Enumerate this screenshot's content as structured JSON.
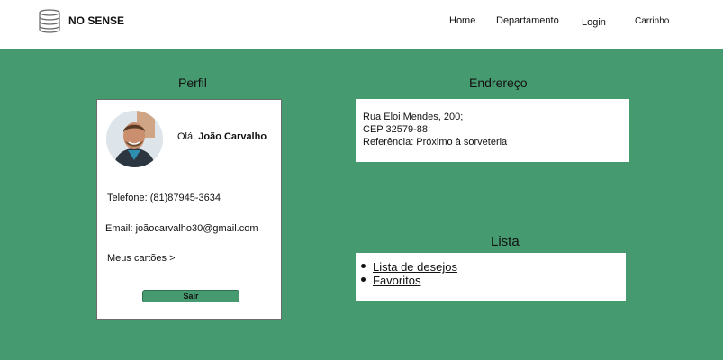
{
  "header": {
    "brand": "NO SENSE",
    "logo_icon": "database-stack-icon",
    "nav": {
      "home": "Home",
      "departamento": "Departamento",
      "login": "Login",
      "carrinho": "Carrinho"
    }
  },
  "perfil": {
    "title": "Perfil",
    "greeting_prefix": "Olá,",
    "name": "João Carvalho",
    "phone": "Telefone: (81)87945-3634",
    "email": "Email: joãocarvalho30@gmail.com",
    "cards_link": "Meus cartões >",
    "logout_label": "Sair"
  },
  "endereco": {
    "title": "Endrereço",
    "lines": [
      "Rua Eloi Mendes, 200;",
      "CEP 32579-88;",
      "Referência: Próximo à sorveteria"
    ]
  },
  "lista": {
    "title": "Lista",
    "items": [
      "Lista de desejos",
      "Favoritos"
    ]
  },
  "colors": {
    "background": "#469a70",
    "button": "#469a70",
    "card": "#ffffff"
  }
}
